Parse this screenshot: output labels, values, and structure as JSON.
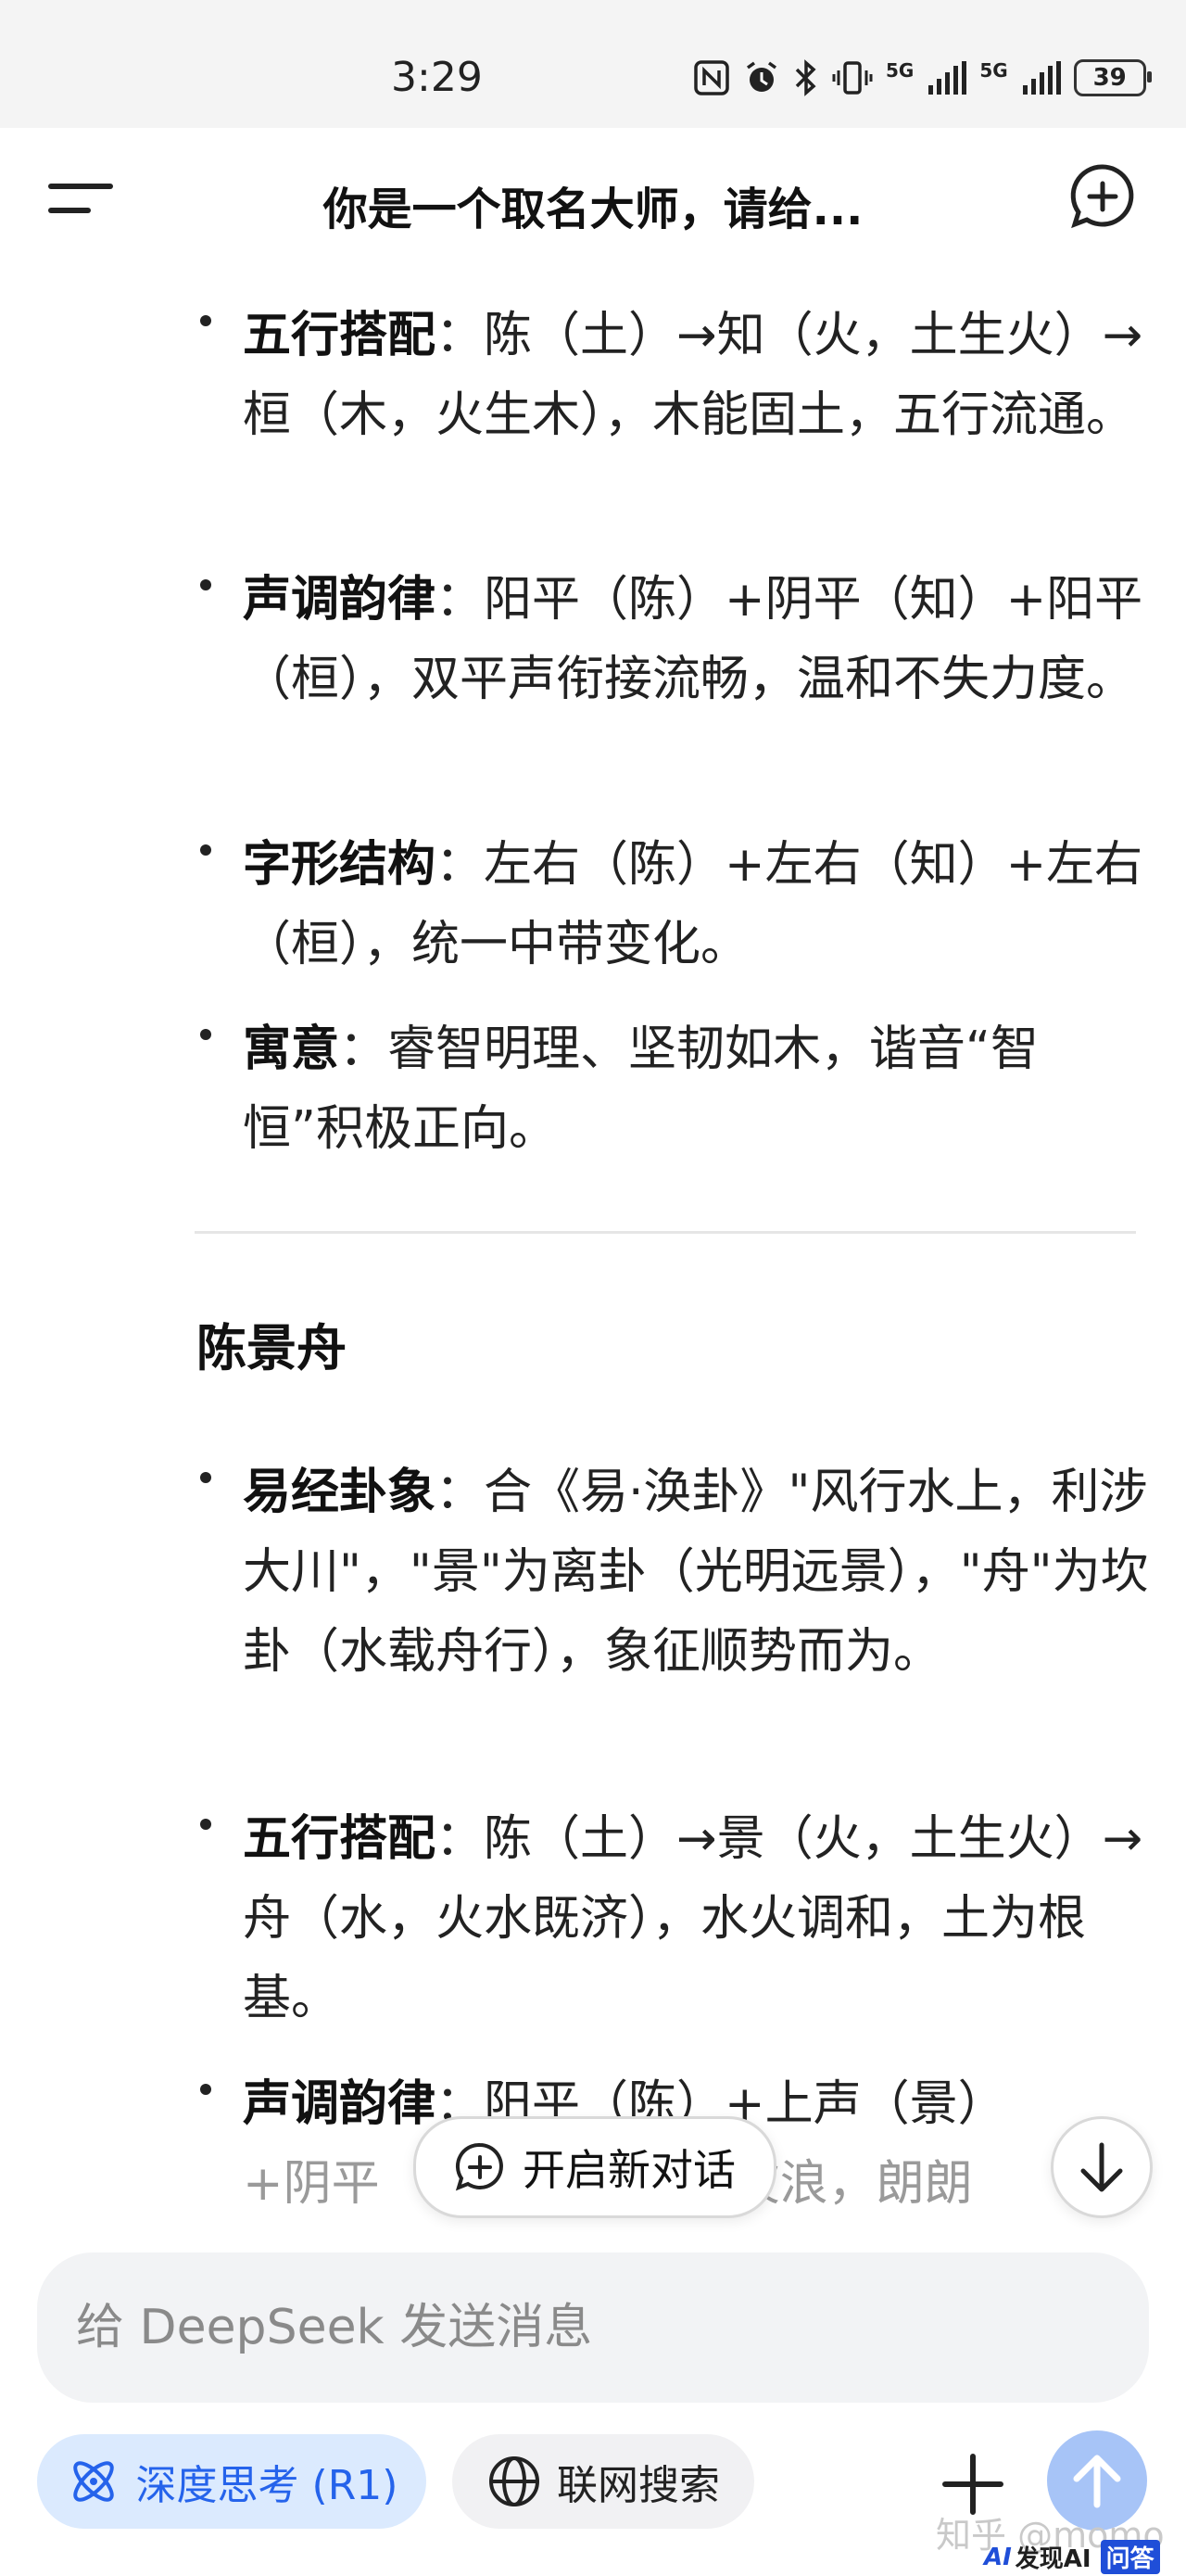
{
  "status_bar": {
    "time": "3:29",
    "icons": [
      "nfc-icon",
      "alarm-icon",
      "bluetooth-icon",
      "vibrate-icon",
      "signal-5g-icon",
      "signal-5g-icon"
    ],
    "network_label": "5G",
    "battery": "39"
  },
  "header": {
    "title": "你是一个取名大师，请给..."
  },
  "content": {
    "name1_items": [
      {
        "label": "五行搭配",
        "sep": "：",
        "text": "陈（土）→知（火，土生火）→桓（木，火生木），木能固土，五行流通。"
      },
      {
        "label": "声调韵律",
        "sep": "：",
        "text": "阳平（陈）+阴平（知）+阳平（桓），双平声衔接流畅，温和不失力度。"
      },
      {
        "label": "字形结构",
        "sep": "：",
        "text": "左右（陈）+左右（知）+左右（桓），统一中带变化。"
      },
      {
        "label": "寓意",
        "sep": "：",
        "text": "睿智明理、坚韧如木，谐音“智恒”积极正向。"
      }
    ],
    "section2_title": "陈景舟",
    "name2_items": [
      {
        "label": "易经卦象",
        "sep": "：",
        "text": "合《易·涣卦》\"风行水上，利涉大川\"，\"景\"为离卦（光明远景），\"舟\"为坎卦（水载舟行），象征顺势而为。"
      },
      {
        "label": "五行搭配",
        "sep": "：",
        "text": "陈（土）→景（火，土生火）→舟（水，火水既济），水火调和，土为根基。"
      },
      {
        "label": "声调韵律",
        "sep": "：",
        "text": "阳平（陈）+上声（景）"
      }
    ],
    "faded_prefix": "+阴平",
    "faded_suffix": "波浪，朗朗"
  },
  "floating": {
    "new_dialog_label": "开启新对话"
  },
  "input": {
    "placeholder": "给 DeepSeek 发送消息"
  },
  "toolbar": {
    "deep_think_label": "深度思考 (R1)",
    "web_search_label": "联网搜索"
  },
  "watermark": {
    "text": "知乎 @momo",
    "logo_ai": "AI",
    "logo_text": "发现AI",
    "logo_tag": "问答"
  },
  "colors": {
    "accent": "#2563eb",
    "send_button": "#a7c4f7",
    "deep_pill_bg": "#dbeafe"
  }
}
